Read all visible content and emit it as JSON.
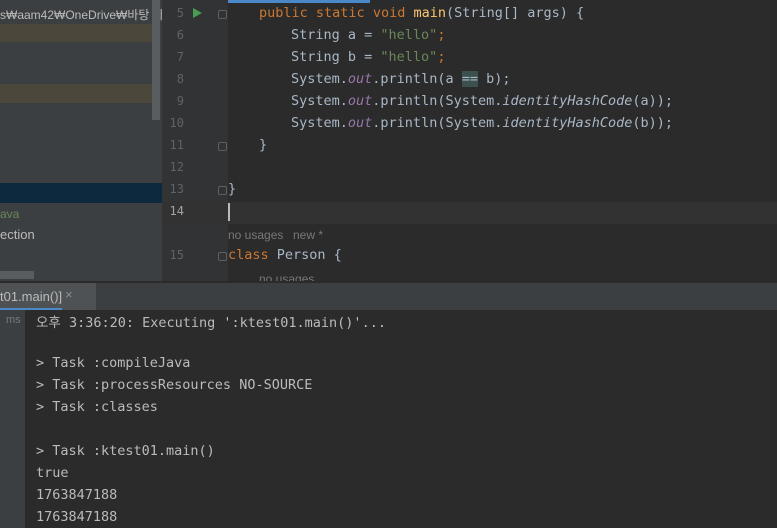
{
  "project_panel": {
    "path_text": "s₩aam42₩OneDrive₩바탕 화",
    "item_java": "ava",
    "item_ection": "ection"
  },
  "editor": {
    "line_numbers": [
      "5",
      "6",
      "7",
      "8",
      "9",
      "10",
      "11",
      "12",
      "13",
      "14",
      "15"
    ],
    "hints": {
      "no_usages": "no usages",
      "new_star": "new *",
      "no_usages_cut": "no usages"
    },
    "code": {
      "l5": {
        "kw1": "public",
        "kw2": "static",
        "kw3": "void",
        "fn": "main",
        "rest": "(String[] args) {"
      },
      "l6": {
        "type": "String a = ",
        "str": "\"hello\"",
        "semi": ";"
      },
      "l7": {
        "type": "String b = ",
        "str": "\"hello\"",
        "semi": ";"
      },
      "l8": {
        "pre": "System.",
        "fld": "out",
        "mid": ".println(a ",
        "op": "==",
        "post": " b);"
      },
      "l9": {
        "pre": "System.",
        "fld": "out",
        "mid": ".println(System.",
        "it": "identityHashCode",
        "post": "(a));"
      },
      "l10": {
        "pre": "System.",
        "fld": "out",
        "mid": ".println(System.",
        "it": "identityHashCode",
        "post": "(b));"
      },
      "l11": "}",
      "l13": "}",
      "l15": {
        "kw": "class",
        "rest": " Person {"
      }
    }
  },
  "run_window": {
    "tab_label": "t01.main()]",
    "close_glyph": "×",
    "tree_time": "ms",
    "console_lines": [
      "오후 3:36:20: Executing ':ktest01.main()'...",
      "",
      "> Task :compileJava",
      "> Task :processResources NO-SOURCE",
      "> Task :classes",
      "",
      "> Task :ktest01.main()",
      "true",
      "1763847188",
      "1763847188"
    ]
  },
  "colors": {
    "keyword": "#cc7832",
    "string": "#6a8759",
    "function": "#ffc66d",
    "field": "#9876aa",
    "selection": "#0d293e",
    "accent": "#4a88c7"
  }
}
